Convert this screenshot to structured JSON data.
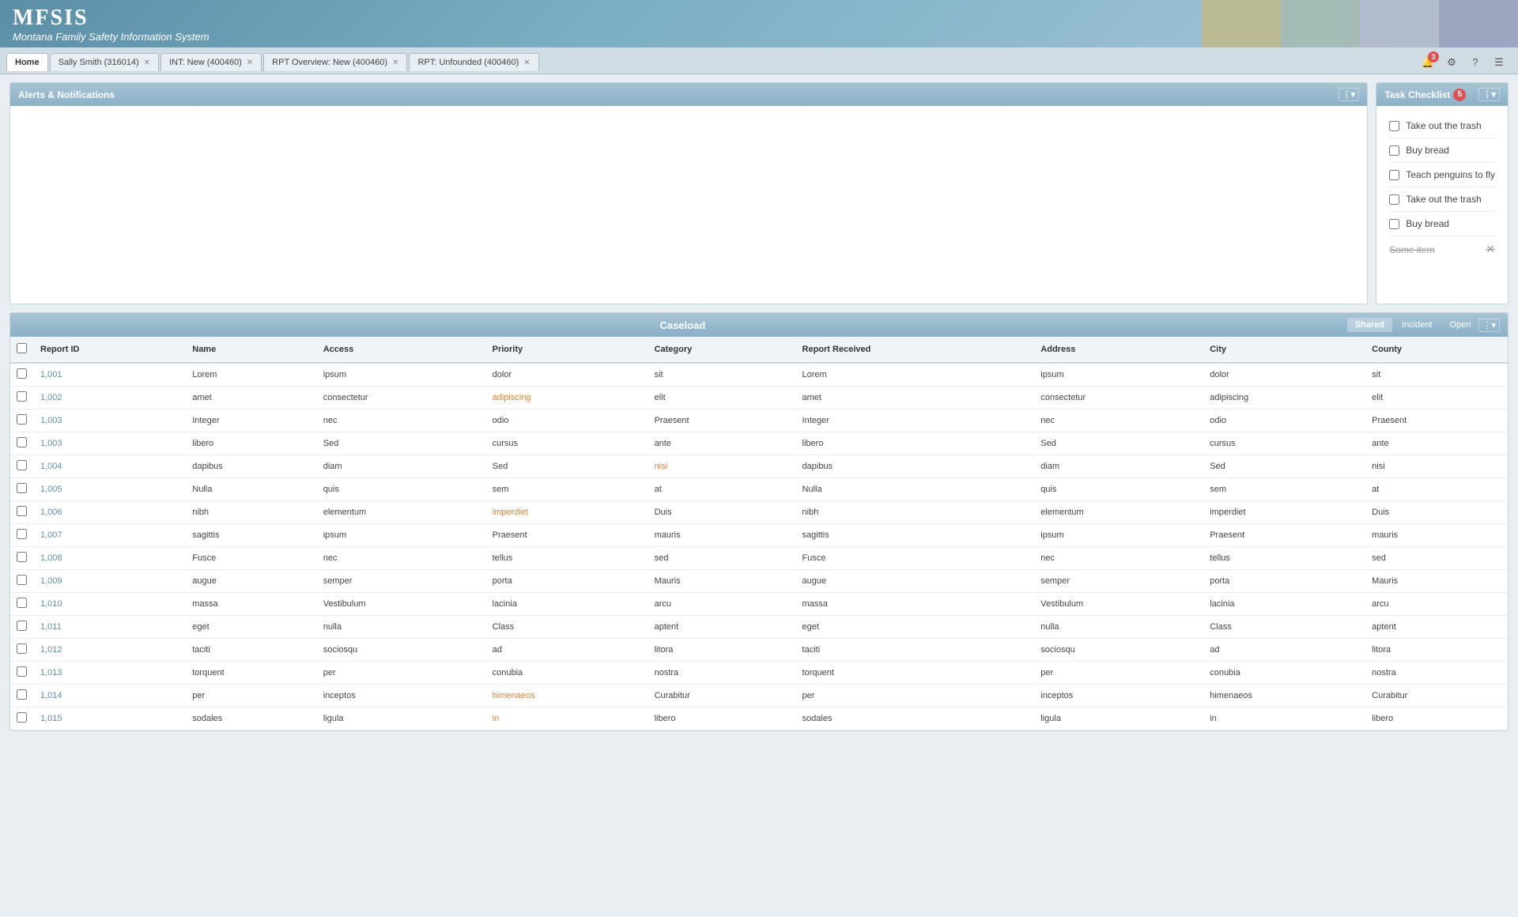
{
  "header": {
    "logo_main": "MFSIS",
    "logo_sub": "Montana Family Safety Information System"
  },
  "tabs": {
    "items": [
      {
        "id": "home",
        "label": "Home",
        "closable": false,
        "active": true
      },
      {
        "id": "sally",
        "label": "Sally Smith (316014)",
        "closable": true,
        "active": false
      },
      {
        "id": "int",
        "label": "INT: New (400460)",
        "closable": true,
        "active": false
      },
      {
        "id": "rpt-overview",
        "label": "RPT Overview: New (400460)",
        "closable": true,
        "active": false
      },
      {
        "id": "rpt-unfounded",
        "label": "RPT: Unfounded (400460)",
        "closable": true,
        "active": false
      }
    ],
    "notification_count": "3"
  },
  "alerts_panel": {
    "title": "Alerts & Notifications"
  },
  "task_panel": {
    "title": "Task Checklist",
    "badge": "5",
    "items": [
      {
        "id": 1,
        "label": "Take out the trash",
        "checked": false,
        "strikethrough": false
      },
      {
        "id": 2,
        "label": "Buy bread",
        "checked": false,
        "strikethrough": false
      },
      {
        "id": 3,
        "label": "Teach penguins to fly",
        "checked": false,
        "strikethrough": false
      },
      {
        "id": 4,
        "label": "Take out the trash",
        "checked": false,
        "strikethrough": false
      },
      {
        "id": 5,
        "label": "Buy bread",
        "checked": false,
        "strikethrough": false
      },
      {
        "id": 6,
        "label": "Some item",
        "checked": false,
        "strikethrough": true
      }
    ]
  },
  "caseload": {
    "title": "Caseload",
    "tabs": [
      {
        "id": "shared",
        "label": "Shared",
        "active": true
      },
      {
        "id": "incident",
        "label": "Incident",
        "active": false
      },
      {
        "id": "open",
        "label": "Open",
        "active": false
      }
    ],
    "columns": [
      "Report ID",
      "Name",
      "Access",
      "Priority",
      "Category",
      "Report Received",
      "Address",
      "City",
      "County"
    ],
    "rows": [
      {
        "report_id": "1,001",
        "name": "Lorem",
        "access": "ipsum",
        "priority": "dolor",
        "category": "sit",
        "report_received": "Lorem",
        "address": "ipsum",
        "city": "dolor",
        "county": "sit",
        "priority_link": false,
        "category_link": false
      },
      {
        "report_id": "1,002",
        "name": "amet",
        "access": "consectetur",
        "priority": "adipiscing",
        "category": "elit",
        "report_received": "amet",
        "address": "consectetur",
        "city": "adipiscing",
        "county": "elit",
        "priority_link": true,
        "category_link": false
      },
      {
        "report_id": "1,003",
        "name": "Integer",
        "access": "nec",
        "priority": "odio",
        "category": "Praesent",
        "report_received": "Integer",
        "address": "nec",
        "city": "odio",
        "county": "Praesent",
        "priority_link": false,
        "category_link": false
      },
      {
        "report_id": "1,003",
        "name": "libero",
        "access": "Sed",
        "priority": "cursus",
        "category": "ante",
        "report_received": "libero",
        "address": "Sed",
        "city": "cursus",
        "county": "ante",
        "priority_link": false,
        "category_link": false
      },
      {
        "report_id": "1,004",
        "name": "dapibus",
        "access": "diam",
        "priority": "Sed",
        "category": "nisi",
        "report_received": "dapibus",
        "address": "diam",
        "city": "Sed",
        "county": "nisi",
        "priority_link": false,
        "category_link": true
      },
      {
        "report_id": "1,005",
        "name": "Nulla",
        "access": "quis",
        "priority": "sem",
        "category": "at",
        "report_received": "Nulla",
        "address": "quis",
        "city": "sem",
        "county": "at",
        "priority_link": false,
        "category_link": false
      },
      {
        "report_id": "1,006",
        "name": "nibh",
        "access": "elementum",
        "priority": "imperdiet",
        "category": "Duis",
        "report_received": "nibh",
        "address": "elementum",
        "city": "imperdiet",
        "county": "Duis",
        "priority_link": true,
        "category_link": false
      },
      {
        "report_id": "1,007",
        "name": "sagittis",
        "access": "ipsum",
        "priority": "Praesent",
        "category": "mauris",
        "report_received": "sagittis",
        "address": "ipsum",
        "city": "Praesent",
        "county": "mauris",
        "priority_link": false,
        "category_link": false
      },
      {
        "report_id": "1,008",
        "name": "Fusce",
        "access": "nec",
        "priority": "tellus",
        "category": "sed",
        "report_received": "Fusce",
        "address": "nec",
        "city": "tellus",
        "county": "sed",
        "priority_link": false,
        "category_link": false
      },
      {
        "report_id": "1,009",
        "name": "augue",
        "access": "semper",
        "priority": "porta",
        "category": "Mauris",
        "report_received": "augue",
        "address": "semper",
        "city": "porta",
        "county": "Mauris",
        "priority_link": false,
        "category_link": false
      },
      {
        "report_id": "1,010",
        "name": "massa",
        "access": "Vestibulum",
        "priority": "lacinia",
        "category": "arcu",
        "report_received": "massa",
        "address": "Vestibulum",
        "city": "lacinia",
        "county": "arcu",
        "priority_link": false,
        "category_link": false
      },
      {
        "report_id": "1,011",
        "name": "eget",
        "access": "nulla",
        "priority": "Class",
        "category": "aptent",
        "report_received": "eget",
        "address": "nulla",
        "city": "Class",
        "county": "aptent",
        "priority_link": false,
        "category_link": false
      },
      {
        "report_id": "1,012",
        "name": "taciti",
        "access": "sociosqu",
        "priority": "ad",
        "category": "litora",
        "report_received": "taciti",
        "address": "sociosqu",
        "city": "ad",
        "county": "litora",
        "priority_link": false,
        "category_link": false
      },
      {
        "report_id": "1,013",
        "name": "torquent",
        "access": "per",
        "priority": "conubia",
        "category": "nostra",
        "report_received": "torquent",
        "address": "per",
        "city": "conubia",
        "county": "nostra",
        "priority_link": false,
        "category_link": false
      },
      {
        "report_id": "1,014",
        "name": "per",
        "access": "inceptos",
        "priority": "himenaeos",
        "category": "Curabitur",
        "report_received": "per",
        "address": "inceptos",
        "city": "himenaeos",
        "county": "Curabitur",
        "priority_link": true,
        "category_link": false
      },
      {
        "report_id": "1,015",
        "name": "sodales",
        "access": "ligula",
        "priority": "in",
        "category": "libero",
        "report_received": "sodales",
        "address": "ligula",
        "city": "in",
        "county": "libero",
        "priority_link": true,
        "category_link": false
      }
    ]
  }
}
